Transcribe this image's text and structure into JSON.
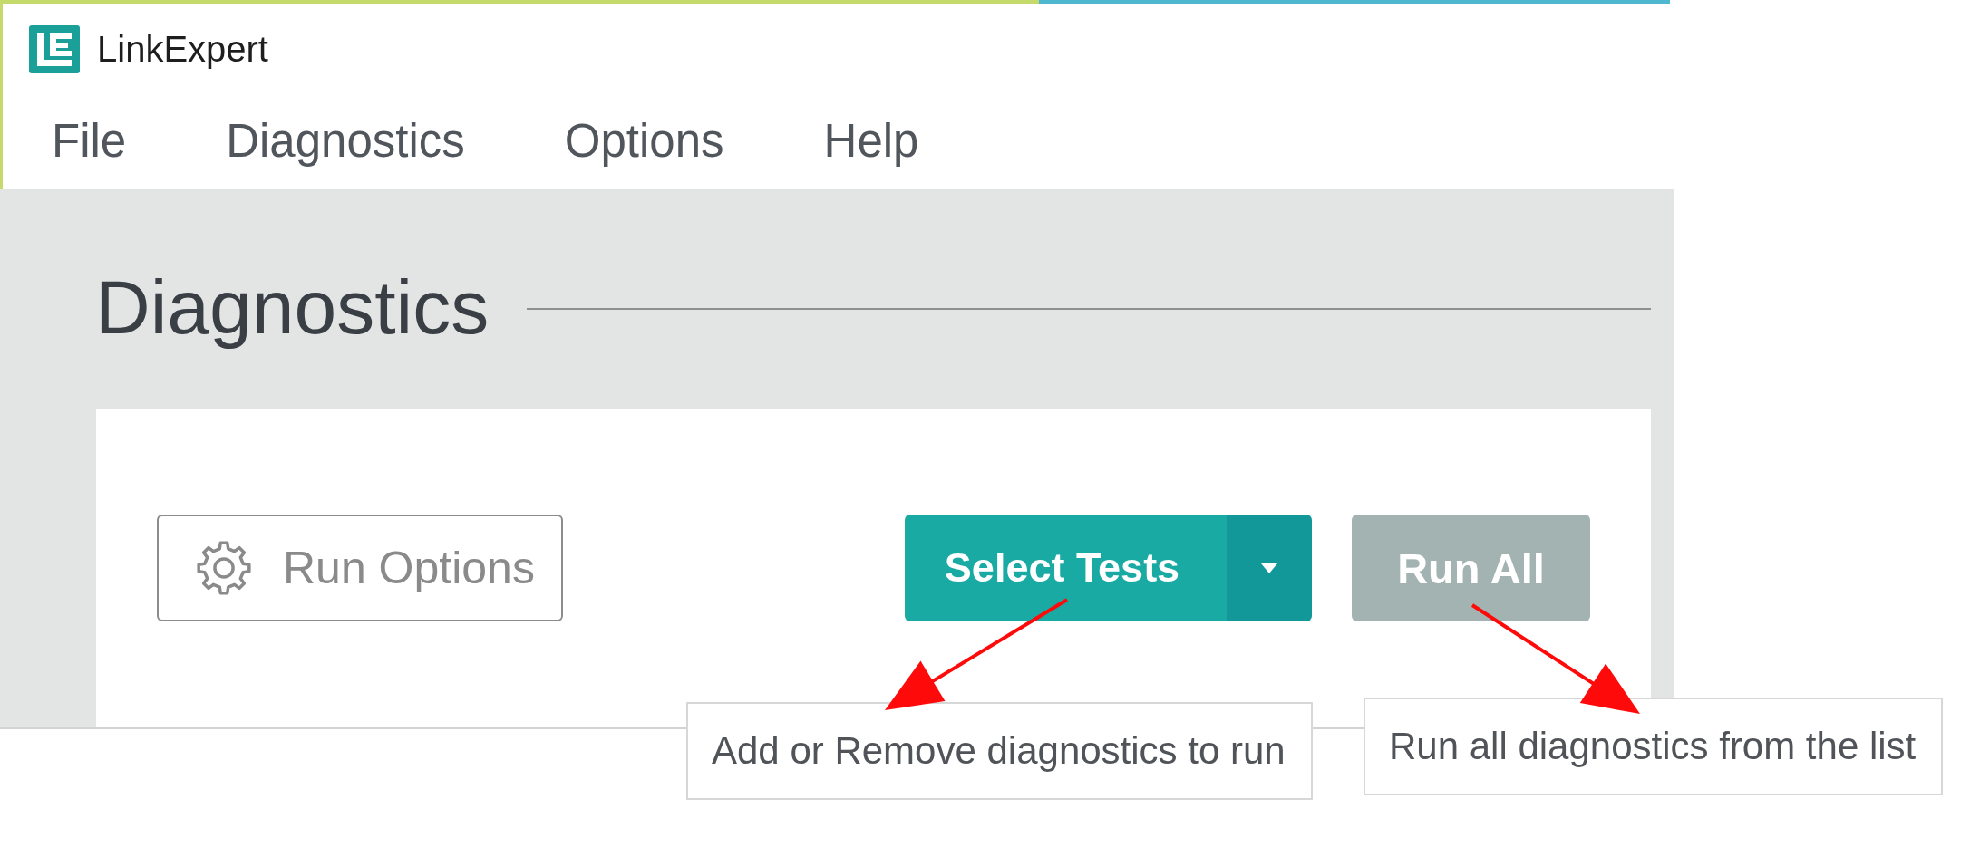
{
  "window": {
    "title": "LinkExpert"
  },
  "menu": [
    {
      "label": "File"
    },
    {
      "label": "Diagnostics"
    },
    {
      "label": "Options"
    },
    {
      "label": "Help"
    }
  ],
  "panel": {
    "heading": "Diagnostics"
  },
  "toolbar": [
    {
      "kind": "outline",
      "label": "Run Options"
    },
    {
      "kind": "split",
      "label": "Select Tests",
      "disabled": false
    },
    {
      "kind": "primary",
      "label": "Run All",
      "disabled": true
    }
  ],
  "callouts": [
    {
      "text": "Add or Remove diagnostics to run"
    },
    {
      "text": "Run all diagnostics from the list"
    }
  ]
}
